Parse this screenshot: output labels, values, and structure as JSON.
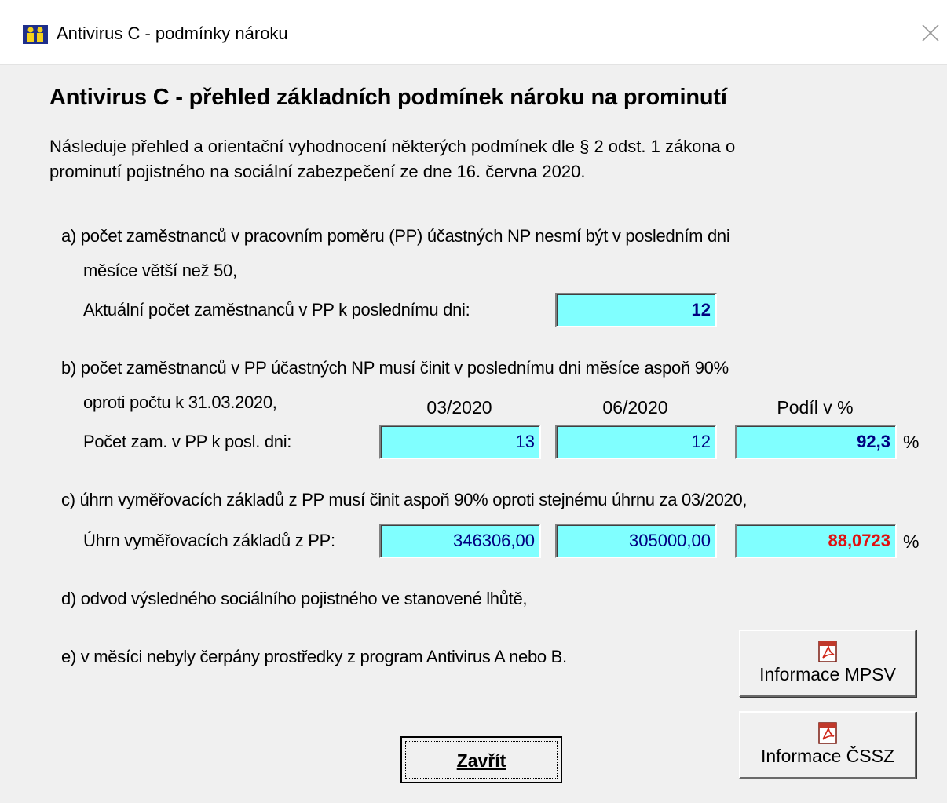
{
  "window": {
    "title": "Antivirus C - podmínky nároku"
  },
  "heading": "Antivirus C - přehled základních podmínek nároku na prominutí",
  "intro": [
    "Následuje přehled a orientační vyhodnocení některých podmínek dle § 2 odst. 1 zákona o",
    "prominutí pojistného na sociální zabezpečení ze dne 16. června 2020."
  ],
  "section_a": {
    "line1": "a) počet zaměstnanců v pracovním poměru (PP) účastných NP nesmí být v posledním dni",
    "line2": "měsíce větší než 50,",
    "label": "Aktuální počet zaměstnanců v PP k poslednímu dni:",
    "value": "12"
  },
  "section_b": {
    "line1": "b) počet zaměstnanců v PP účastných NP musí činit v poslednímu dni měsíce aspoň 90%",
    "line2": "oproti počtu k 31.03.2020,",
    "col1": "03/2020",
    "col2": "06/2020",
    "col3": "Podíl v %",
    "label": "Počet zam. v PP k posl. dni:",
    "v1": "13",
    "v2": "12",
    "v3": "92,3",
    "unit": "%"
  },
  "section_c": {
    "line1": "c) úhrn vyměřovacích základů z PP musí činit aspoň 90% oproti stejnému úhrnu za 03/2020,",
    "label": "Úhrn vyměřovacích základů z PP:",
    "v1": "346306,00",
    "v2": "305000,00",
    "v3": "88,0723",
    "unit": "%"
  },
  "section_d": {
    "line1": "d) odvod výsledného sociálního pojistného ve stanovené lhůtě,"
  },
  "section_e": {
    "line1": "e) v měsíci nebyly čerpány prostředky z program Antivirus A nebo B."
  },
  "buttons": {
    "mpsv": "Informace MPSV",
    "cssz": "Informace ČSSZ",
    "close": "Zavřít"
  },
  "colors": {
    "field_bg": "#80ffff",
    "warning_value": "#e01010",
    "value_text": "#000080"
  }
}
